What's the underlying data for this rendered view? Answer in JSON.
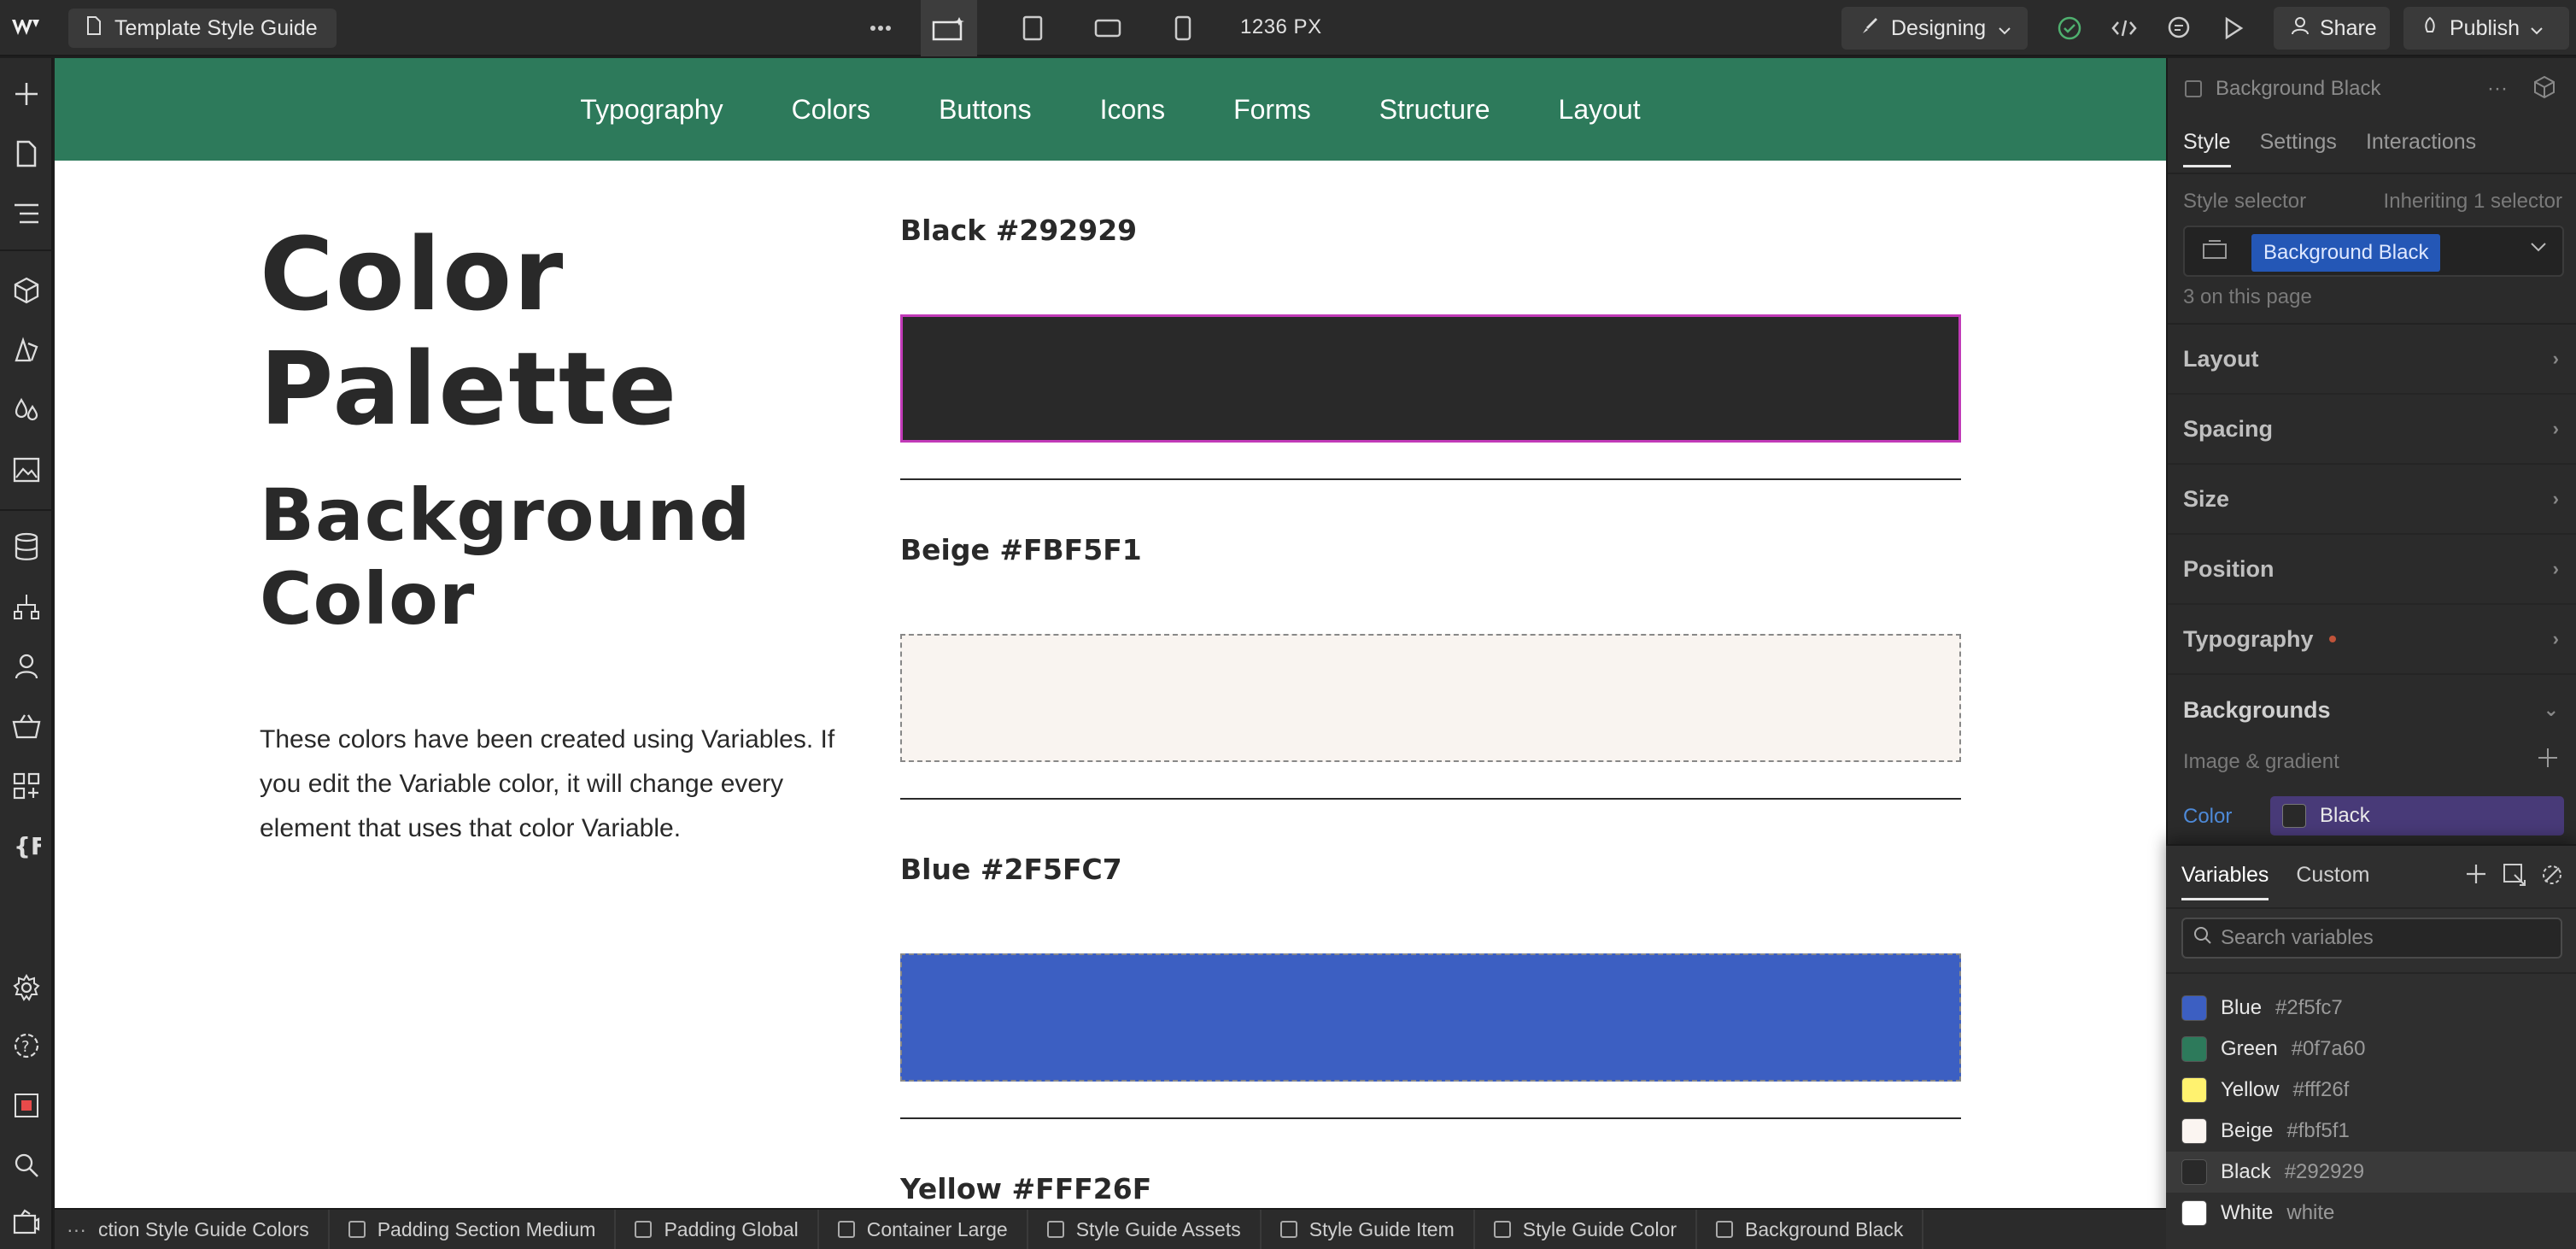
{
  "topbar": {
    "page_name": "Template Style Guide",
    "canvas_width": "1236 PX",
    "mode": "Designing",
    "share": "Share",
    "publish": "Publish"
  },
  "nav": [
    "Typography",
    "Colors",
    "Buttons",
    "Icons",
    "Forms",
    "Structure",
    "Layout"
  ],
  "hero": {
    "title_line1": "Color",
    "title_line2": "Palette",
    "subtitle_line1": "Background",
    "subtitle_line2": "Color",
    "description": "These colors have been created using Variables. If you edit the Variable color, it will change every element that uses that color Variable."
  },
  "swatches": [
    {
      "label": "Black #292929",
      "color": "#292929"
    },
    {
      "label": "Beige #FBF5F1",
      "color": "#f9f4f0"
    },
    {
      "label": "Blue #2F5FC7",
      "color": "#3c5fc2"
    },
    {
      "label": "Yellow #FFF26F",
      "color": "#fff26f"
    }
  ],
  "panel": {
    "element_name": "Background Black",
    "tabs": [
      "Style",
      "Settings",
      "Interactions"
    ],
    "style_selector_label": "Style selector",
    "inheriting": "Inheriting 1 selector",
    "selector_chip": "Background Black",
    "on_page": "3 on this page",
    "sections": [
      "Layout",
      "Spacing",
      "Size",
      "Position",
      "Typography",
      "Backgrounds"
    ],
    "image_gradient": "Image & gradient",
    "color_label": "Color",
    "color_value": "Black"
  },
  "variables_popover": {
    "tabs": [
      "Variables",
      "Custom"
    ],
    "search_placeholder": "Search variables",
    "items": [
      {
        "name": "Blue",
        "value": "#2f5fc7",
        "color": "#3c5fc2"
      },
      {
        "name": "Green",
        "value": "#0f7a60",
        "color": "#2d7a5b"
      },
      {
        "name": "Yellow",
        "value": "#fff26f",
        "color": "#fff26f"
      },
      {
        "name": "Beige",
        "value": "#fbf5f1",
        "color": "#fbf5f1"
      },
      {
        "name": "Black",
        "value": "#292929",
        "color": "#292929"
      },
      {
        "name": "White",
        "value": "white",
        "color": "#ffffff"
      }
    ]
  },
  "breadcrumbs": [
    "ction Style Guide Colors",
    "Padding Section Medium",
    "Padding Global",
    "Container Large",
    "Style Guide Assets",
    "Style Guide Item",
    "Style Guide Color",
    "Background Black"
  ]
}
